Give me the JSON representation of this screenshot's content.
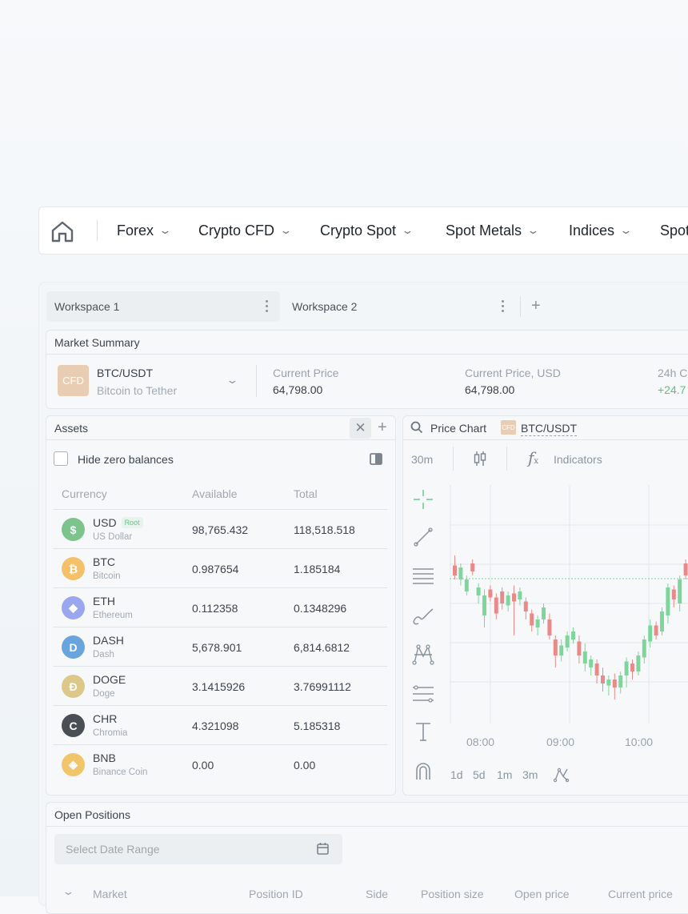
{
  "nav": {
    "items": [
      {
        "label": "Forex"
      },
      {
        "label": "Crypto CFD"
      },
      {
        "label": "Crypto Spot"
      },
      {
        "label": "Spot Metals"
      },
      {
        "label": "Indices"
      },
      {
        "label": "Spot"
      }
    ]
  },
  "workspaces": [
    {
      "label": "Workspace 1",
      "active": true
    },
    {
      "label": "Workspace 2",
      "active": false
    }
  ],
  "market_summary": {
    "title": "Market Summary",
    "badge": "CFD",
    "pair": "BTC/USDT",
    "pair_name": "Bitcoin to Tether",
    "current_price_label": "Current Price",
    "current_price": "64,798.00",
    "current_price_usd_label": "Current Price, USD",
    "current_price_usd": "64,798.00",
    "change_label": "24h C",
    "change_value": "+24.7"
  },
  "assets": {
    "title": "Assets",
    "hide_zero_label": "Hide zero balances",
    "columns": [
      "Currency",
      "Available",
      "Total"
    ],
    "rows": [
      {
        "symbol": "USD",
        "name": "US Dollar",
        "available": "98,765.432",
        "total": "118,518.518",
        "tag": "Root",
        "color": "#7cc48c",
        "glyph": "$"
      },
      {
        "symbol": "BTC",
        "name": "Bitcoin",
        "available": "0.987654",
        "total": "1.185184",
        "color": "#f4c06a",
        "glyph": "₿"
      },
      {
        "symbol": "ETH",
        "name": "Ethereum",
        "available": "0.112358",
        "total": "0.1348296",
        "color": "#9aa7ee",
        "glyph": "◆"
      },
      {
        "symbol": "DASH",
        "name": "Dash",
        "available": "5,678.901",
        "total": "6,814.6812",
        "color": "#6aa4dc",
        "glyph": "D"
      },
      {
        "symbol": "DOGE",
        "name": "Doge",
        "available": "3.1415926",
        "total": "3.76991112",
        "color": "#dcc98a",
        "glyph": "Ð"
      },
      {
        "symbol": "CHR",
        "name": "Chromia",
        "available": "4.321098",
        "total": "5.185318",
        "color": "#4a4f55",
        "glyph": "C"
      },
      {
        "symbol": "BNB",
        "name": "Binance Coin",
        "available": "0.00",
        "total": "0.00",
        "color": "#f1c56a",
        "glyph": "◈"
      }
    ]
  },
  "price_chart": {
    "title": "Price Chart",
    "badge": "CFD",
    "pair": "BTC/USDT",
    "interval": "30m",
    "indicators_label": "Indicators",
    "x_labels": [
      "08:00",
      "09:00",
      "10:00"
    ],
    "timeframes": [
      "1d",
      "5d",
      "1m",
      "3m"
    ]
  },
  "chart_data": {
    "type": "candlestick",
    "x": [
      "08:00",
      "09:00",
      "10:00"
    ],
    "candles_note": "",
    "candles": [
      [
        1,
        0.3,
        0.25,
        0.2,
        0.32,
        0.18
      ],
      [
        0,
        0.26,
        0.32,
        0.24,
        0.35,
        0.22
      ],
      [
        0,
        0.32,
        0.38,
        0.3,
        0.4,
        0.28
      ],
      [
        1,
        0.28,
        0.24,
        0.22,
        0.3,
        0.2
      ],
      [
        0,
        0.36,
        0.4,
        0.34,
        0.44,
        0.32
      ],
      [
        0,
        0.4,
        0.5,
        0.37,
        0.56,
        0.35
      ],
      [
        1,
        0.41,
        0.37,
        0.35,
        0.43,
        0.33
      ],
      [
        1,
        0.49,
        0.41,
        0.39,
        0.52,
        0.37
      ],
      [
        1,
        0.44,
        0.38,
        0.36,
        0.47,
        0.34
      ],
      [
        0,
        0.4,
        0.45,
        0.38,
        0.48,
        0.36
      ],
      [
        1,
        0.43,
        0.39,
        0.35,
        0.6,
        0.34
      ],
      [
        0,
        0.38,
        0.42,
        0.36,
        0.45,
        0.34
      ],
      [
        1,
        0.48,
        0.43,
        0.41,
        0.52,
        0.39
      ],
      [
        1,
        0.55,
        0.49,
        0.47,
        0.58,
        0.44
      ],
      [
        0,
        0.52,
        0.56,
        0.5,
        0.6,
        0.48
      ],
      [
        0,
        0.46,
        0.52,
        0.44,
        0.54,
        0.42
      ],
      [
        1,
        0.6,
        0.52,
        0.49,
        0.62,
        0.46
      ],
      [
        1,
        0.7,
        0.62,
        0.6,
        0.76,
        0.58
      ],
      [
        0,
        0.65,
        0.7,
        0.62,
        0.73,
        0.6
      ],
      [
        0,
        0.6,
        0.66,
        0.58,
        0.68,
        0.55
      ],
      [
        0,
        0.58,
        0.62,
        0.56,
        0.64,
        0.54
      ],
      [
        1,
        0.7,
        0.63,
        0.6,
        0.74,
        0.58
      ],
      [
        0,
        0.68,
        0.74,
        0.64,
        0.78,
        0.62
      ],
      [
        0,
        0.72,
        0.76,
        0.7,
        0.8,
        0.68
      ],
      [
        1,
        0.8,
        0.74,
        0.72,
        0.84,
        0.7
      ],
      [
        1,
        0.84,
        0.8,
        0.76,
        0.88,
        0.74
      ],
      [
        0,
        0.82,
        0.85,
        0.8,
        0.9,
        0.78
      ],
      [
        1,
        0.86,
        0.82,
        0.79,
        0.92,
        0.77
      ],
      [
        0,
        0.8,
        0.86,
        0.78,
        0.89,
        0.75
      ],
      [
        0,
        0.73,
        0.8,
        0.71,
        0.86,
        0.68
      ],
      [
        1,
        0.78,
        0.74,
        0.72,
        0.82,
        0.7
      ],
      [
        0,
        0.7,
        0.78,
        0.68,
        0.8,
        0.66
      ],
      [
        0,
        0.62,
        0.71,
        0.6,
        0.74,
        0.58
      ],
      [
        0,
        0.55,
        0.63,
        0.52,
        0.66,
        0.5
      ],
      [
        1,
        0.6,
        0.55,
        0.53,
        0.62,
        0.5
      ],
      [
        0,
        0.48,
        0.58,
        0.46,
        0.6,
        0.44
      ],
      [
        0,
        0.36,
        0.5,
        0.34,
        0.54,
        0.32
      ],
      [
        1,
        0.42,
        0.37,
        0.35,
        0.46,
        0.33
      ],
      [
        0,
        0.32,
        0.44,
        0.3,
        0.48,
        0.28
      ],
      [
        1,
        0.3,
        0.24,
        0.22,
        0.32,
        0.2
      ],
      [
        0,
        0.22,
        0.28,
        0.2,
        0.3,
        0.18
      ]
    ]
  }
}
